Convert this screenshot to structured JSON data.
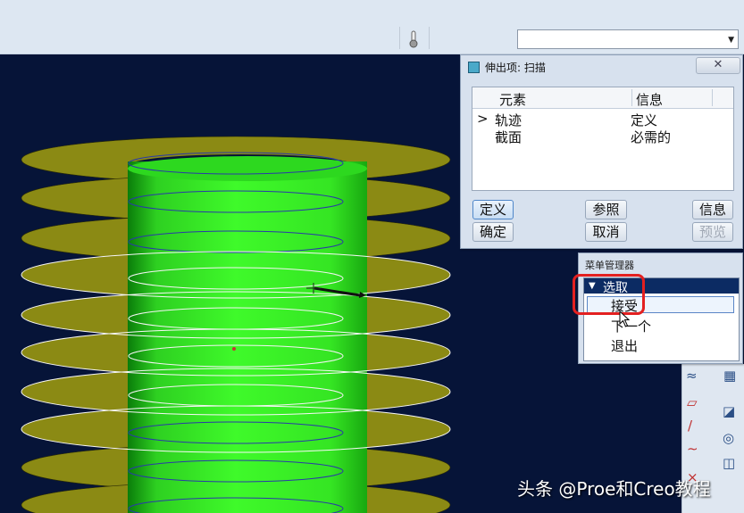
{
  "toolbar": {
    "filter_value": "",
    "icons": [
      "thermometer-icon",
      "dropdown-arrow-icon"
    ]
  },
  "sweep_dialog": {
    "title": "伸出项: 扫描",
    "columns": [
      "元素",
      "信息"
    ],
    "rows": [
      {
        "marker": ">",
        "element": "轨迹",
        "info": "定义"
      },
      {
        "marker": "",
        "element": "截面",
        "info": "必需的"
      }
    ],
    "buttons": {
      "define": "定义",
      "refs": "参照",
      "info": "信息",
      "ok": "确定",
      "cancel": "取消",
      "preview": "预览"
    }
  },
  "menu_manager": {
    "title": "菜单管理器",
    "header": "选取",
    "items": [
      "接受",
      "下一个",
      "退出"
    ]
  },
  "watermark": "头条 @Proe和Creo教程",
  "colors": {
    "viewport_bg": "#061438",
    "thread_olive": "#8b8a14",
    "cylinder_green": "#33ee22",
    "highlight_red": "#e32020",
    "menu_header_bg": "#0c2b63"
  }
}
